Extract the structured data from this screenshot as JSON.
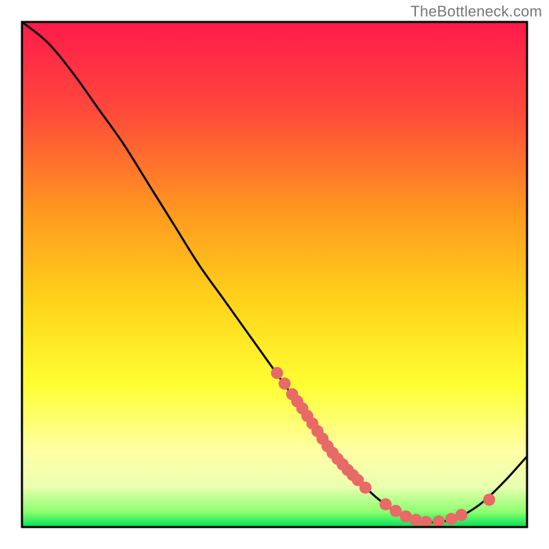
{
  "attribution": "TheBottleneck.com",
  "chart_data": {
    "type": "line",
    "title": "",
    "xlabel": "",
    "ylabel": "",
    "xlim": [
      0,
      100
    ],
    "ylim": [
      0,
      100
    ],
    "grid": false,
    "legend": false,
    "background_gradient_stops": [
      {
        "offset": 0,
        "color": "#ff1a4b"
      },
      {
        "offset": 18,
        "color": "#ff4a3a"
      },
      {
        "offset": 38,
        "color": "#ff9a1f"
      },
      {
        "offset": 55,
        "color": "#ffd21a"
      },
      {
        "offset": 72,
        "color": "#ffff33"
      },
      {
        "offset": 85,
        "color": "#ffffa5"
      },
      {
        "offset": 92,
        "color": "#eaffb0"
      },
      {
        "offset": 97,
        "color": "#8dff70"
      },
      {
        "offset": 100,
        "color": "#00e05a"
      }
    ],
    "series": [
      {
        "name": "bottleneck-curve",
        "color": "#000000",
        "x": [
          0,
          5,
          10,
          15,
          20,
          25,
          30,
          35,
          40,
          45,
          50,
          55,
          60,
          65,
          70,
          75,
          80,
          85,
          90,
          95,
          100
        ],
        "y": [
          100,
          96,
          90,
          83,
          76,
          68,
          60,
          52,
          45,
          38,
          31,
          24,
          17,
          11,
          6,
          2.5,
          1,
          1.5,
          4,
          8.5,
          14
        ]
      }
    ],
    "highlight_points": {
      "color": "#e76a66",
      "radius": 1.2,
      "points": [
        {
          "x": 50.5,
          "y": 30.5
        },
        {
          "x": 52.0,
          "y": 28.4
        },
        {
          "x": 53.5,
          "y": 26.3
        },
        {
          "x": 54.5,
          "y": 24.9
        },
        {
          "x": 55.5,
          "y": 23.5
        },
        {
          "x": 56.5,
          "y": 22.0
        },
        {
          "x": 57.5,
          "y": 20.5
        },
        {
          "x": 58.5,
          "y": 19.0
        },
        {
          "x": 59.5,
          "y": 17.5
        },
        {
          "x": 60.5,
          "y": 16.0
        },
        {
          "x": 61.5,
          "y": 14.7
        },
        {
          "x": 62.5,
          "y": 13.5
        },
        {
          "x": 63.5,
          "y": 12.4
        },
        {
          "x": 64.5,
          "y": 11.3
        },
        {
          "x": 65.5,
          "y": 10.3
        },
        {
          "x": 66.5,
          "y": 9.3
        },
        {
          "x": 68.0,
          "y": 7.8
        },
        {
          "x": 72.0,
          "y": 4.5
        },
        {
          "x": 74.0,
          "y": 3.2
        },
        {
          "x": 76.0,
          "y": 2.1
        },
        {
          "x": 78.0,
          "y": 1.4
        },
        {
          "x": 80.0,
          "y": 1.0
        },
        {
          "x": 82.5,
          "y": 1.1
        },
        {
          "x": 85.0,
          "y": 1.6
        },
        {
          "x": 87.0,
          "y": 2.4
        },
        {
          "x": 92.5,
          "y": 5.4
        }
      ]
    }
  }
}
